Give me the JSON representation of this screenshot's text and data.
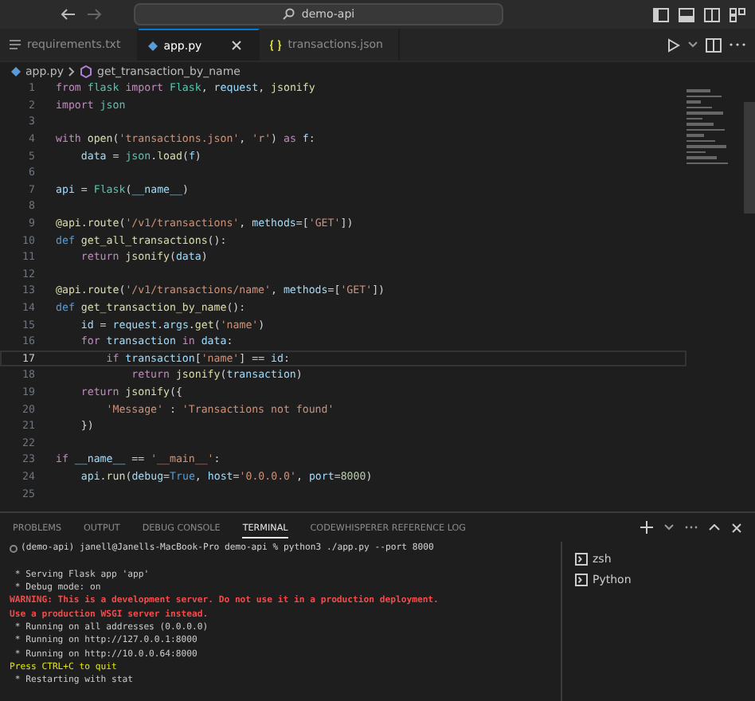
{
  "title_bar": {
    "search": "demo-api"
  },
  "tabs": [
    {
      "label": "requirements.txt",
      "selected": false
    },
    {
      "label": "app.py",
      "selected": true
    },
    {
      "label": "transactions.json",
      "selected": false
    }
  ],
  "breadcrumb": {
    "file": "app.py",
    "symbol": "get_transaction_by_name"
  },
  "code": [
    {
      "number": "1",
      "current": false,
      "tokens": [
        {
          "kind": "kw",
          "text": "from "
        },
        {
          "kind": "cls",
          "text": "flask "
        },
        {
          "kind": "kw",
          "text": "import "
        },
        {
          "kind": "cls",
          "text": "Flask"
        },
        {
          "kind": "plain",
          "text": ", "
        },
        {
          "kind": "var",
          "text": "request"
        },
        {
          "kind": "plain",
          "text": ", "
        },
        {
          "kind": "fn",
          "text": "jsonify"
        }
      ]
    },
    {
      "number": "2",
      "current": false,
      "tokens": [
        {
          "kind": "kw",
          "text": "import "
        },
        {
          "kind": "cls",
          "text": "json"
        }
      ]
    },
    {
      "number": "3",
      "current": false
    },
    {
      "number": "4",
      "current": false,
      "tokens": [
        {
          "kind": "kw",
          "text": "with "
        },
        {
          "kind": "fn",
          "text": "open"
        },
        {
          "kind": "plain",
          "text": "("
        },
        {
          "kind": "str",
          "text": "'transactions.json'"
        },
        {
          "kind": "plain",
          "text": ", "
        },
        {
          "kind": "str",
          "text": "'r'"
        },
        {
          "kind": "plain",
          "text": ") "
        },
        {
          "kind": "kw",
          "text": "as "
        },
        {
          "kind": "var",
          "text": "f"
        },
        {
          "kind": "plain",
          "text": ":"
        }
      ]
    },
    {
      "number": "5",
      "current": false,
      "tokens": [
        {
          "kind": "var",
          "text": "    data "
        },
        {
          "kind": "plain",
          "text": "= "
        },
        {
          "kind": "cls",
          "text": "json"
        },
        {
          "kind": "plain",
          "text": "."
        },
        {
          "kind": "fn",
          "text": "load"
        },
        {
          "kind": "plain",
          "text": "("
        },
        {
          "kind": "var",
          "text": "f"
        },
        {
          "kind": "plain",
          "text": ")"
        }
      ]
    },
    {
      "number": "6",
      "current": false
    },
    {
      "number": "7",
      "current": false,
      "tokens": [
        {
          "kind": "var",
          "text": "api "
        },
        {
          "kind": "plain",
          "text": "= "
        },
        {
          "kind": "cls",
          "text": "Flask"
        },
        {
          "kind": "plain",
          "text": "("
        },
        {
          "kind": "var",
          "text": "__name__"
        },
        {
          "kind": "plain",
          "text": ")"
        }
      ]
    },
    {
      "number": "8",
      "current": false
    },
    {
      "number": "9",
      "current": false,
      "tokens": [
        {
          "kind": "fn",
          "text": "@api.route"
        },
        {
          "kind": "plain",
          "text": "("
        },
        {
          "kind": "str",
          "text": "'/v1/transactions'"
        },
        {
          "kind": "plain",
          "text": ", "
        },
        {
          "kind": "var",
          "text": "methods"
        },
        {
          "kind": "plain",
          "text": "=["
        },
        {
          "kind": "str",
          "text": "'GET'"
        },
        {
          "kind": "plain",
          "text": "])"
        }
      ]
    },
    {
      "number": "10",
      "current": false,
      "tokens": [
        {
          "kind": "def",
          "text": "def "
        },
        {
          "kind": "fn",
          "text": "get_all_transactions"
        },
        {
          "kind": "plain",
          "text": "():"
        }
      ]
    },
    {
      "number": "11",
      "current": false,
      "tokens": [
        {
          "kind": "kw",
          "text": "    return "
        },
        {
          "kind": "fn",
          "text": "jsonify"
        },
        {
          "kind": "plain",
          "text": "("
        },
        {
          "kind": "var",
          "text": "data"
        },
        {
          "kind": "plain",
          "text": ")"
        }
      ]
    },
    {
      "number": "12",
      "current": false
    },
    {
      "number": "13",
      "current": false,
      "tokens": [
        {
          "kind": "fn",
          "text": "@api.route"
        },
        {
          "kind": "plain",
          "text": "("
        },
        {
          "kind": "str",
          "text": "'/v1/transactions/name'"
        },
        {
          "kind": "plain",
          "text": ", "
        },
        {
          "kind": "var",
          "text": "methods"
        },
        {
          "kind": "plain",
          "text": "=["
        },
        {
          "kind": "str",
          "text": "'GET'"
        },
        {
          "kind": "plain",
          "text": "])"
        }
      ]
    },
    {
      "number": "14",
      "current": false,
      "tokens": [
        {
          "kind": "def",
          "text": "def "
        },
        {
          "kind": "fn",
          "text": "get_transaction_by_name"
        },
        {
          "kind": "plain",
          "text": "():"
        }
      ]
    },
    {
      "number": "15",
      "current": false,
      "tokens": [
        {
          "kind": "var",
          "text": "    id "
        },
        {
          "kind": "plain",
          "text": "= "
        },
        {
          "kind": "var",
          "text": "request"
        },
        {
          "kind": "plain",
          "text": "."
        },
        {
          "kind": "var",
          "text": "args"
        },
        {
          "kind": "plain",
          "text": "."
        },
        {
          "kind": "fn",
          "text": "get"
        },
        {
          "kind": "plain",
          "text": "("
        },
        {
          "kind": "str",
          "text": "'name'"
        },
        {
          "kind": "plain",
          "text": ")"
        }
      ]
    },
    {
      "number": "16",
      "current": false,
      "tokens": [
        {
          "kind": "kw",
          "text": "    for "
        },
        {
          "kind": "var",
          "text": "transaction "
        },
        {
          "kind": "kw",
          "text": "in "
        },
        {
          "kind": "var",
          "text": "data"
        },
        {
          "kind": "plain",
          "text": ":"
        }
      ]
    },
    {
      "number": "17",
      "current": true,
      "tokens": [
        {
          "kind": "kw",
          "text": "        if "
        },
        {
          "kind": "var",
          "text": "transaction"
        },
        {
          "kind": "plain",
          "text": "["
        },
        {
          "kind": "str",
          "text": "'name'"
        },
        {
          "kind": "plain",
          "text": "] == "
        },
        {
          "kind": "var",
          "text": "id"
        },
        {
          "kind": "plain",
          "text": ":"
        }
      ]
    },
    {
      "number": "18",
      "current": false,
      "tokens": [
        {
          "kind": "kw",
          "text": "            return "
        },
        {
          "kind": "fn",
          "text": "jsonify"
        },
        {
          "kind": "plain",
          "text": "("
        },
        {
          "kind": "var",
          "text": "transaction"
        },
        {
          "kind": "plain",
          "text": ")"
        }
      ]
    },
    {
      "number": "19",
      "current": false,
      "tokens": [
        {
          "kind": "kw",
          "text": "    return "
        },
        {
          "kind": "fn",
          "text": "jsonify"
        },
        {
          "kind": "plain",
          "text": "({"
        }
      ]
    },
    {
      "number": "20",
      "current": false,
      "tokens": [
        {
          "kind": "str",
          "text": "        'Message'"
        },
        {
          "kind": "plain",
          "text": " : "
        },
        {
          "kind": "str",
          "text": "'Transactions not found'"
        }
      ]
    },
    {
      "number": "21",
      "current": false,
      "tokens": [
        {
          "kind": "plain",
          "text": "    })"
        }
      ]
    },
    {
      "number": "22",
      "current": false
    },
    {
      "number": "23",
      "current": false,
      "tokens": [
        {
          "kind": "kw",
          "text": "if "
        },
        {
          "kind": "var",
          "text": "__name__"
        },
        {
          "kind": "plain",
          "text": " == "
        },
        {
          "kind": "str",
          "text": "'__main__'"
        },
        {
          "kind": "plain",
          "text": ":"
        }
      ]
    },
    {
      "number": "24",
      "current": false,
      "tokens": [
        {
          "kind": "var",
          "text": "    api"
        },
        {
          "kind": "plain",
          "text": "."
        },
        {
          "kind": "fn",
          "text": "run"
        },
        {
          "kind": "plain",
          "text": "("
        },
        {
          "kind": "var",
          "text": "debug"
        },
        {
          "kind": "plain",
          "text": "="
        },
        {
          "kind": "def",
          "text": "True"
        },
        {
          "kind": "plain",
          "text": ", "
        },
        {
          "kind": "var",
          "text": "host"
        },
        {
          "kind": "plain",
          "text": "="
        },
        {
          "kind": "str",
          "text": "'0.0.0.0'"
        },
        {
          "kind": "plain",
          "text": ", "
        },
        {
          "kind": "var",
          "text": "port"
        },
        {
          "kind": "plain",
          "text": "="
        },
        {
          "kind": "num",
          "text": "8000"
        },
        {
          "kind": "plain",
          "text": ")"
        }
      ]
    },
    {
      "number": "25",
      "current": false
    }
  ],
  "panel_tabs": [
    {
      "label": "PROBLEMS",
      "selected": false
    },
    {
      "label": "OUTPUT",
      "selected": false
    },
    {
      "label": "DEBUG CONSOLE",
      "selected": false
    },
    {
      "label": "TERMINAL",
      "selected": true
    },
    {
      "label": "CODEWHISPERER REFERENCE LOG",
      "selected": false
    }
  ],
  "terminal": [
    {
      "kind": "prompt",
      "text": "(demo-api) janell@Janells-MacBook-Pro demo-api % python3 ./app.py --port 8000"
    },
    {
      "kind": "blank"
    },
    {
      "kind": "normal",
      "text": " * Serving Flask app 'app'"
    },
    {
      "kind": "normal",
      "text": " * Debug mode: on"
    },
    {
      "kind": "warning",
      "text": "WARNING: This is a development server. Do not use it in a production deployment."
    },
    {
      "kind": "warning",
      "text": "Use a production WSGI server instead."
    },
    {
      "kind": "normal",
      "text": " * Running on all addresses (0.0.0.0)"
    },
    {
      "kind": "normal",
      "text": " * Running on http://127.0.0.1:8000"
    },
    {
      "kind": "normal",
      "text": " * Running on http://10.0.0.64:8000"
    },
    {
      "kind": "hint",
      "text": "Press CTRL+C to quit"
    },
    {
      "kind": "normal",
      "text": " * Restarting with stat"
    }
  ],
  "terminal_list": [
    {
      "label": "zsh",
      "selected": false
    },
    {
      "label": "Python",
      "selected": false
    }
  ]
}
